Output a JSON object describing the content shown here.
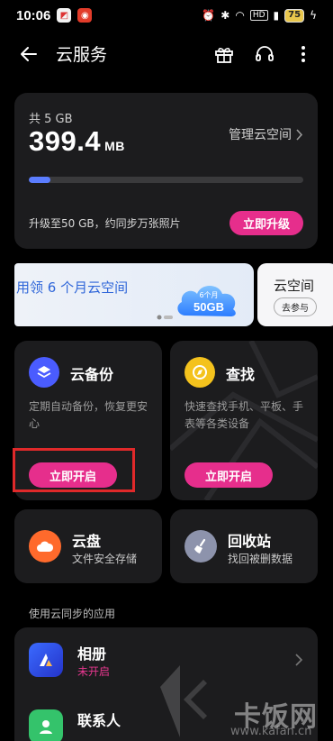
{
  "status": {
    "time": "10:06",
    "battery": "75",
    "hd": "HD"
  },
  "header": {
    "title": "云服务"
  },
  "storage": {
    "total_label": "共 5 GB",
    "used_value": "399.4",
    "used_unit": "MB",
    "manage_label": "管理云空间",
    "progress_fraction": 0.08,
    "upgrade_text": "升级至50 GB，约同步万张照片",
    "upgrade_button": "立即升级"
  },
  "banner": {
    "text": "用领 6 个月云空间",
    "art_line1": "6个月",
    "art_line2": "50GB",
    "next_text": "云空间",
    "next_button": "去参与"
  },
  "features": {
    "backup": {
      "title": "云备份",
      "desc": "定期自动备份，恢复更安心",
      "button": "立即开启"
    },
    "find": {
      "title": "查找",
      "desc": "快速查找手机、平板、手表等各类设备",
      "button": "立即开启"
    }
  },
  "mini": {
    "drive": {
      "title": "云盘",
      "sub": "文件安全存储"
    },
    "recycle": {
      "title": "回收站",
      "sub": "找回被删数据"
    }
  },
  "apps_section": {
    "label": "使用云同步的应用",
    "items": [
      {
        "name": "相册",
        "status": "未开启"
      },
      {
        "name": "联系人",
        "status": ""
      }
    ]
  },
  "watermark": {
    "text": "卡饭网",
    "url": "www.kafan.cn"
  },
  "colors": {
    "accent": "#e62e8c",
    "card": "#1c1c1e",
    "progress": "#5b7dff",
    "highlight": "#e0292a"
  }
}
